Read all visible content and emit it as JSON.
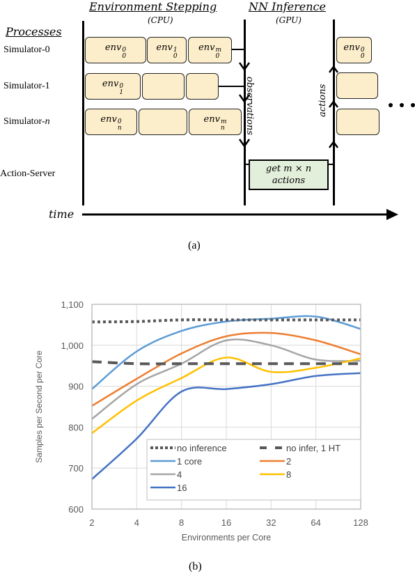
{
  "diagram": {
    "headers": {
      "env_stepping": "Environment Stepping",
      "env_stepping_sub": "(CPU)",
      "nn_inference": "NN Inference",
      "nn_inference_sub": "(GPU)",
      "processes": "Processes"
    },
    "processes": [
      {
        "label": "Simulator-0",
        "name": "Simulator-",
        "idx": "0"
      },
      {
        "label": "Simulator-1",
        "name": "Simulator-",
        "idx": "1"
      },
      {
        "label": "Simulator-n",
        "name": "Simulator-",
        "idx": "n"
      },
      {
        "label": "Action-Server"
      }
    ],
    "rows": [
      {
        "boxes": [
          {
            "base": "env",
            "sup": "0",
            "sub": "0"
          },
          {
            "base": "env",
            "sup": "1",
            "sub": "0"
          },
          {
            "base": "env",
            "sup": "m",
            "sub": "0"
          }
        ]
      },
      {
        "boxes": [
          {
            "base": "env",
            "sup": "0",
            "sub": "1"
          },
          {
            "base": ""
          },
          {
            "base": ""
          }
        ]
      },
      {
        "boxes": [
          {
            "base": "env",
            "sup": "0",
            "sub": "n"
          },
          {
            "base": ""
          },
          {
            "base": "env",
            "sup": "m",
            "sub": "n"
          }
        ]
      }
    ],
    "next_boxes": [
      {
        "base": "env",
        "sup": "0",
        "sub": "0"
      },
      {
        "base": ""
      },
      {
        "base": ""
      }
    ],
    "observations_label": "observations",
    "actions_label": "actions",
    "action_server_box": {
      "line1": "get m × n",
      "line2": "actions"
    },
    "time_label": "time",
    "ellipsis": "• • •",
    "colors": {
      "env_box": "#fdeecb",
      "action_box": "#e2efda"
    },
    "caption": "(a)"
  },
  "chart_caption": "(b)",
  "chart_data": {
    "type": "line",
    "title": "",
    "xlabel": "Environments per Core",
    "ylabel": "Samples per Second per Core",
    "x": [
      "2",
      "4",
      "8",
      "16",
      "32",
      "64",
      "128"
    ],
    "x_scale": "log2",
    "ylim": [
      600,
      1100
    ],
    "yticks": [
      600,
      700,
      800,
      900,
      1000,
      1100
    ],
    "ytick_labels": [
      "600",
      "700",
      "800",
      "900",
      "1,000",
      "1,100"
    ],
    "grid": true,
    "legend_position": "bottom-center inside plot",
    "series": [
      {
        "name": "no inference",
        "style": "dotted",
        "color": "#595959",
        "values": [
          1057,
          1058,
          1062,
          1062,
          1062,
          1062,
          1062
        ]
      },
      {
        "name": "no infer, 1 HT",
        "style": "dashed",
        "color": "#595959",
        "values": [
          960,
          955,
          955,
          955,
          955,
          955,
          955
        ]
      },
      {
        "name": "1 core",
        "style": "solid",
        "color": "#5b9bd5",
        "values": [
          893,
          985,
          1035,
          1058,
          1065,
          1070,
          1040
        ]
      },
      {
        "name": "2",
        "style": "solid",
        "color": "#ed7d31",
        "values": [
          852,
          918,
          980,
          1022,
          1030,
          1012,
          978
        ]
      },
      {
        "name": "4",
        "style": "solid",
        "color": "#a5a5a5",
        "values": [
          820,
          905,
          955,
          1012,
          1000,
          965,
          962
        ]
      },
      {
        "name": "8",
        "style": "solid",
        "color": "#ffc000",
        "values": [
          785,
          865,
          920,
          970,
          935,
          945,
          968
        ]
      },
      {
        "name": "16",
        "style": "solid",
        "color": "#4472c4",
        "values": [
          673,
          772,
          887,
          893,
          905,
          925,
          932
        ]
      }
    ]
  }
}
